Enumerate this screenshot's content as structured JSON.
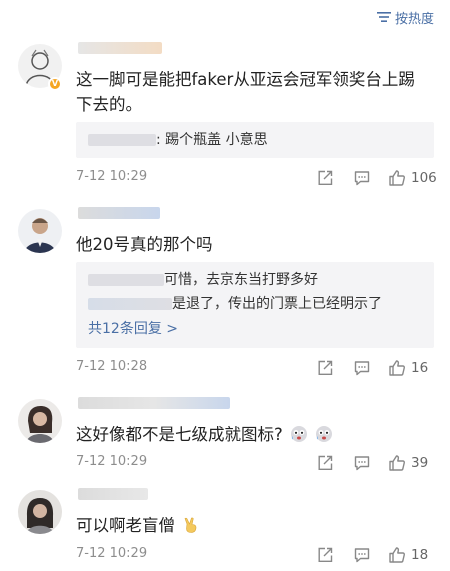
{
  "sort_label": "按热度",
  "comments": [
    {
      "body": "这一脚可是能把faker从亚运会冠军领奖台上踢下去的。",
      "replies": [
        {
          "text": ": 踢个瓶盖 小意思"
        }
      ],
      "time": "7-12 10:29",
      "likes": "106",
      "verified_badge": "V"
    },
    {
      "body": "他20号真的那个吗",
      "replies": [
        {
          "text": "可惜，去京东当打野多好"
        },
        {
          "text": "是退了，传出的门票上已经明示了"
        }
      ],
      "more_replies": "共12条回复 >",
      "time": "7-12 10:28",
      "likes": "16"
    },
    {
      "body": "这好像都不是七级成就图标?",
      "time": "7-12 10:29",
      "likes": "39"
    },
    {
      "body": "可以啊老盲僧",
      "time": "7-12 10:29",
      "likes": "18"
    }
  ],
  "icons": [
    "sort-icon",
    "share-icon",
    "comment-icon",
    "like-icon",
    "scared-face-emoji",
    "victory-hand-emoji"
  ],
  "colors": {
    "link": "#4a6fa5",
    "meta": "#8d8d8d",
    "reply_bg": "#f4f4f6",
    "badge": "#f5a623"
  }
}
